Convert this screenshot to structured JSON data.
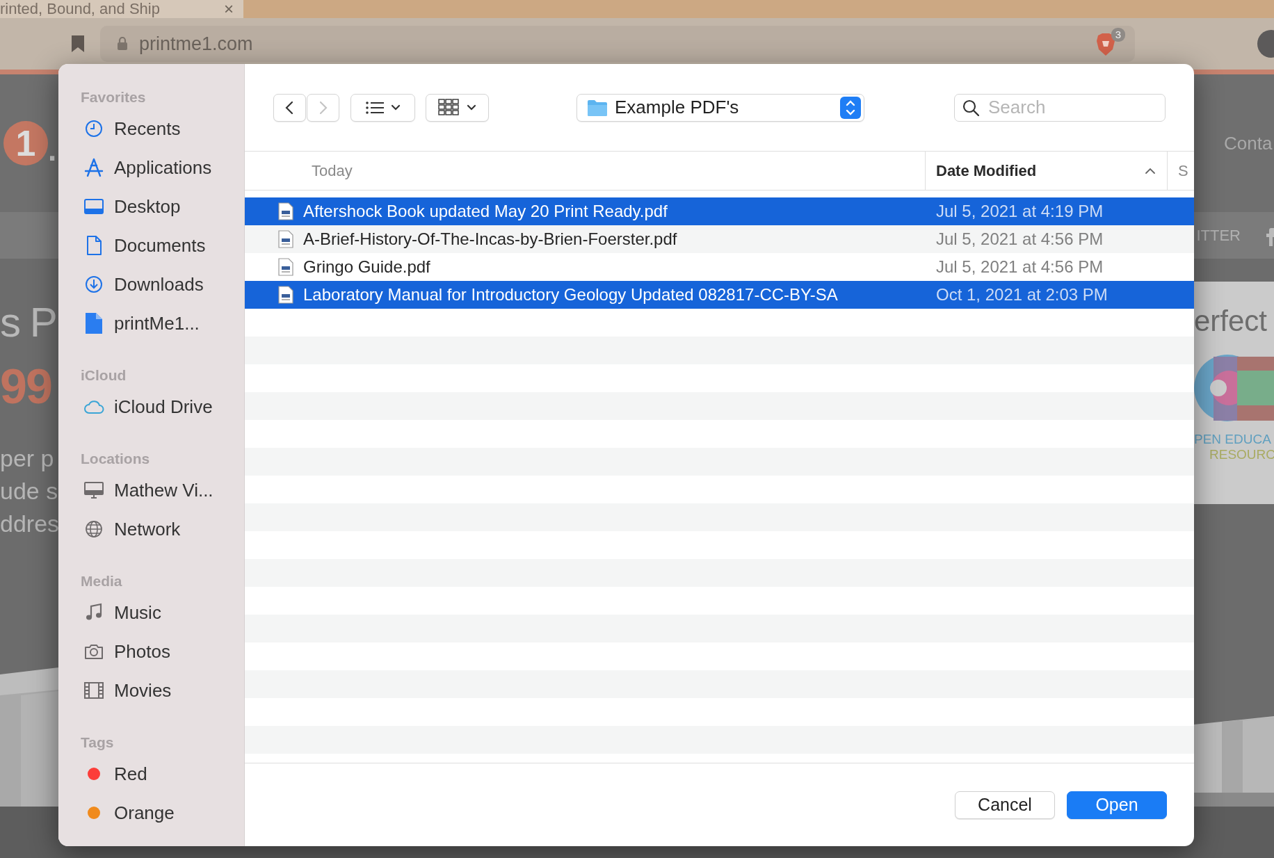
{
  "browser": {
    "tab": {
      "title": "rinted, Bound, and Ship",
      "close": "×"
    },
    "address": "printme1.com",
    "extension_badge": "3"
  },
  "website": {
    "logo_number": "1",
    "logo_dot": ".",
    "nav_link": "Conta",
    "nav_item": "ITTER",
    "left_fragments": [
      {
        "text": "s P",
        "kind": "headline"
      },
      {
        "text": "99",
        "kind": "price"
      },
      {
        "text": "per p",
        "kind": "body"
      },
      {
        "text": "ude s",
        "kind": "body"
      },
      {
        "text": "ddres",
        "kind": "body"
      }
    ],
    "card": {
      "heading": "erfect",
      "lines": [
        "PEN EDUCA",
        "RESOURC"
      ]
    }
  },
  "dialog": {
    "sidebar": [
      {
        "heading": "Favorites",
        "items": [
          {
            "label": "Recents",
            "kind": "place"
          },
          {
            "label": "Applications",
            "kind": "place"
          },
          {
            "label": "Desktop",
            "kind": "place"
          },
          {
            "label": "Documents",
            "kind": "place"
          },
          {
            "label": "Downloads",
            "kind": "place"
          },
          {
            "label": "printMe1...",
            "kind": "place"
          }
        ]
      },
      {
        "heading": "iCloud",
        "items": [
          {
            "label": "iCloud Drive",
            "kind": "place"
          }
        ]
      },
      {
        "heading": "Locations",
        "items": [
          {
            "label": "Mathew Vi...",
            "kind": "place"
          },
          {
            "label": "Network",
            "kind": "place"
          }
        ]
      },
      {
        "heading": "Media",
        "items": [
          {
            "label": "Music",
            "kind": "place"
          },
          {
            "label": "Photos",
            "kind": "place"
          },
          {
            "label": "Movies",
            "kind": "place"
          }
        ]
      },
      {
        "heading": "Tags",
        "items": [
          {
            "label": "Red",
            "kind": "tag",
            "color": "#fc3d39"
          },
          {
            "label": "Orange",
            "kind": "tag",
            "color": "#f08a1c"
          }
        ]
      }
    ],
    "navigation": {
      "back": {
        "disabled": false
      },
      "forward": {
        "disabled": true
      }
    },
    "location": "Example PDF's",
    "search": {
      "placeholder": "Search"
    },
    "columns": [
      {
        "label": "Today",
        "sorted": false
      },
      {
        "label": "Date Modified",
        "sorted": true
      },
      {
        "label": "S",
        "sorted": false
      }
    ],
    "files": [
      {
        "name": "Aftershock Book updated May 20 Print Ready.pdf",
        "date": "Jul 5, 2021 at 4:19 PM",
        "selected": true
      },
      {
        "name": "A-Brief-History-Of-The-Incas-by-Brien-Foerster.pdf",
        "date": "Jul 5, 2021 at 4:56 PM",
        "selected": false
      },
      {
        "name": "Gringo Guide.pdf",
        "date": "Jul 5, 2021 at 4:56 PM",
        "selected": false
      },
      {
        "name": "Laboratory Manual for Introductory Geology Updated 082817-CC-BY-SA",
        "date": "Oct 1, 2021 at 2:03 PM",
        "selected": true
      }
    ],
    "buttons": [
      {
        "label": "Cancel",
        "default": false
      },
      {
        "label": "Open",
        "default": true
      }
    ]
  }
}
